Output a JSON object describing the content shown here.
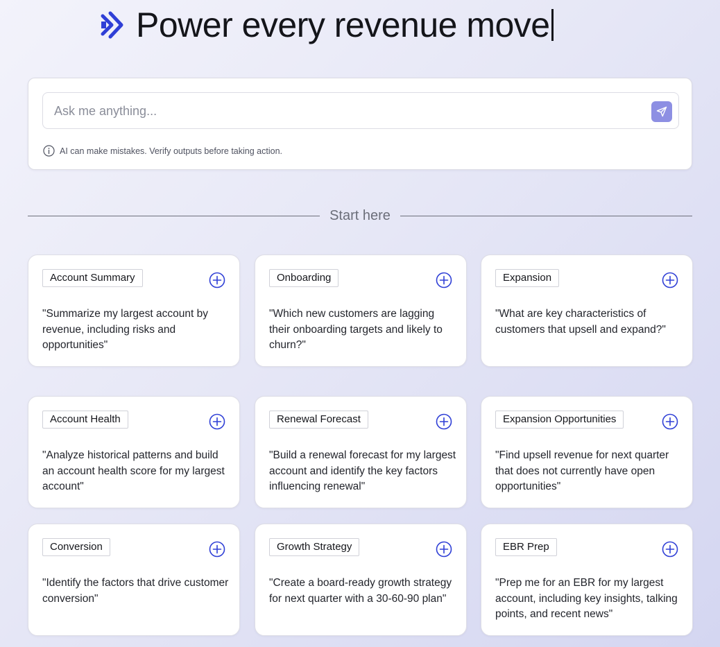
{
  "hero": {
    "headline": "Power every revenue move",
    "logo_icon": "double-chevron-right-icon",
    "accent_color": "#2f3fd6"
  },
  "prompt": {
    "placeholder": "Ask me anything...",
    "value": "",
    "send_icon": "paper-plane-icon",
    "send_color": "#8d8fe3",
    "disclaimer_icon": "info-icon",
    "disclaimer": "AI can make mistakes. Verify outputs before taking action."
  },
  "section": {
    "label": "Start here"
  },
  "cards": [
    {
      "tag": "Account Summary",
      "text": "\"Summarize my largest account by revenue, including risks and opportunities\"",
      "icon": "plus-circle-icon"
    },
    {
      "tag": "Onboarding",
      "text": "\"Which new customers are lagging their onboarding targets and likely to churn?\"",
      "icon": "plus-circle-icon"
    },
    {
      "tag": "Expansion",
      "text": "\"What are key characteristics of customers that upsell and expand?\"",
      "icon": "plus-circle-icon"
    },
    {
      "tag": "Account Health",
      "text": "\"Analyze historical patterns and build an account health score for my largest account\"",
      "icon": "plus-circle-icon"
    },
    {
      "tag": "Renewal Forecast",
      "text": "\"Build a renewal forecast for my largest account and identify the key factors influencing renewal\"",
      "icon": "plus-circle-icon"
    },
    {
      "tag": "Expansion Opportunities",
      "text": "\"Find upsell revenue for next quarter that does not currently have open opportunities\"",
      "icon": "plus-circle-icon"
    },
    {
      "tag": "Conversion",
      "text": "\"Identify the factors that drive customer conversion\"",
      "icon": "plus-circle-icon"
    },
    {
      "tag": "Growth Strategy",
      "text": "\"Create a board-ready growth strategy for next quarter with a 30-60-90 plan\"",
      "icon": "plus-circle-icon"
    },
    {
      "tag": "EBR Prep",
      "text": "\"Prep me for an EBR for my largest account, including key insights, talking points, and recent news\"",
      "icon": "plus-circle-icon"
    }
  ]
}
